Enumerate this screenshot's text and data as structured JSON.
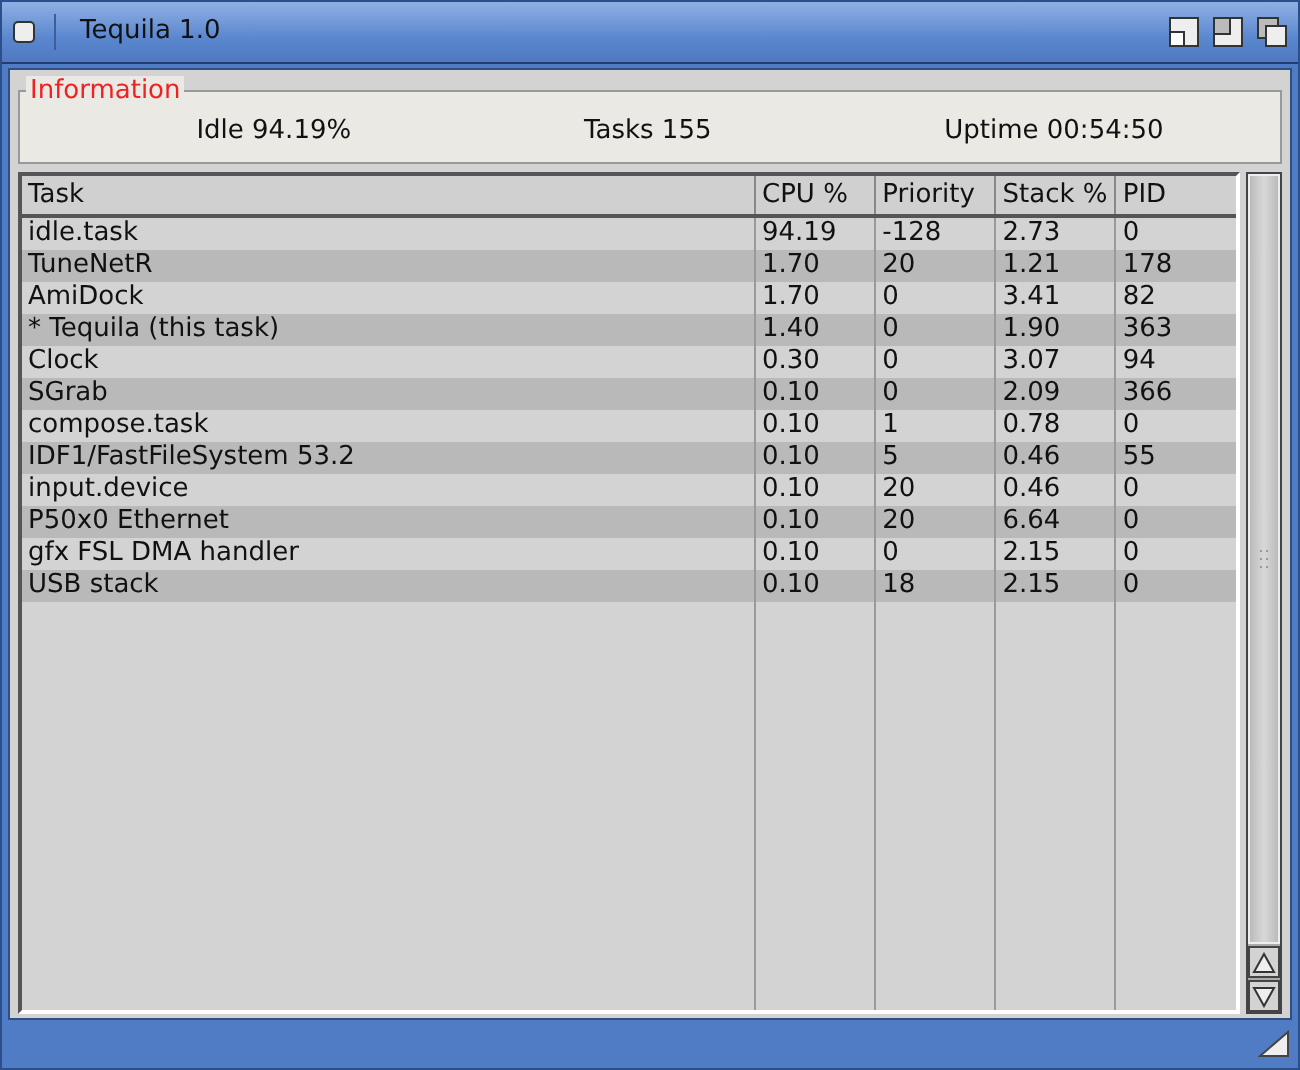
{
  "window": {
    "title": "Tequila 1.0"
  },
  "information": {
    "title": "Information",
    "idle": "Idle 94.19%",
    "tasks": "Tasks 155",
    "uptime": "Uptime 00:54:50"
  },
  "table": {
    "columns": [
      "Task",
      "CPU %",
      "Priority",
      "Stack %",
      "PID"
    ],
    "rows": [
      [
        "idle.task",
        "94.19",
        "-128",
        "2.73",
        "0"
      ],
      [
        "TuneNetR",
        "1.70",
        "20",
        "1.21",
        "178"
      ],
      [
        "AmiDock",
        "1.70",
        "0",
        "3.41",
        "82"
      ],
      [
        "* Tequila (this task)",
        "1.40",
        "0",
        "1.90",
        "363"
      ],
      [
        "Clock",
        "0.30",
        "0",
        "3.07",
        "94"
      ],
      [
        "SGrab",
        "0.10",
        "0",
        "2.09",
        "366"
      ],
      [
        "compose.task",
        "0.10",
        "1",
        "0.78",
        "0"
      ],
      [
        "IDF1/FastFileSystem 53.2",
        "0.10",
        "5",
        "0.46",
        "55"
      ],
      [
        "input.device",
        "0.10",
        "20",
        "0.46",
        "0"
      ],
      [
        "P50x0 Ethernet",
        "0.10",
        "20",
        "6.64",
        "0"
      ],
      [
        "gfx FSL DMA handler",
        "0.10",
        "0",
        "2.15",
        "0"
      ],
      [
        "USB stack",
        "0.10",
        "18",
        "2.15",
        "0"
      ]
    ]
  }
}
